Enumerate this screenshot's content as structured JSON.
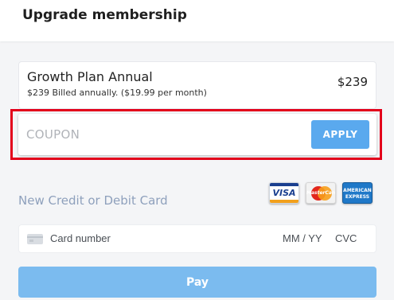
{
  "header": {
    "title": "Upgrade membership"
  },
  "plan": {
    "name": "Growth Plan Annual",
    "billing": "$239 Billed annually. ($19.99 per month)",
    "price": "$239"
  },
  "coupon": {
    "placeholder": "COUPON",
    "value": "",
    "apply_label": "APPLY"
  },
  "payment": {
    "new_card_label": "New Credit or Debit Card",
    "card_logos": [
      {
        "name": "visa-icon",
        "label": "VISA"
      },
      {
        "name": "mastercard-icon",
        "label": "MasterCard"
      },
      {
        "name": "amex-icon",
        "label": "AMERICAN EXPRESS"
      }
    ],
    "card_number_placeholder": "Card number",
    "expiry_placeholder": "MM / YY",
    "cvc_placeholder": "CVC",
    "pay_label": "Pay"
  },
  "colors": {
    "accent": "#5aa9ee",
    "pay_button": "#7bbbef",
    "highlight": "#e3001b",
    "muted_label": "#8ea0bc"
  }
}
